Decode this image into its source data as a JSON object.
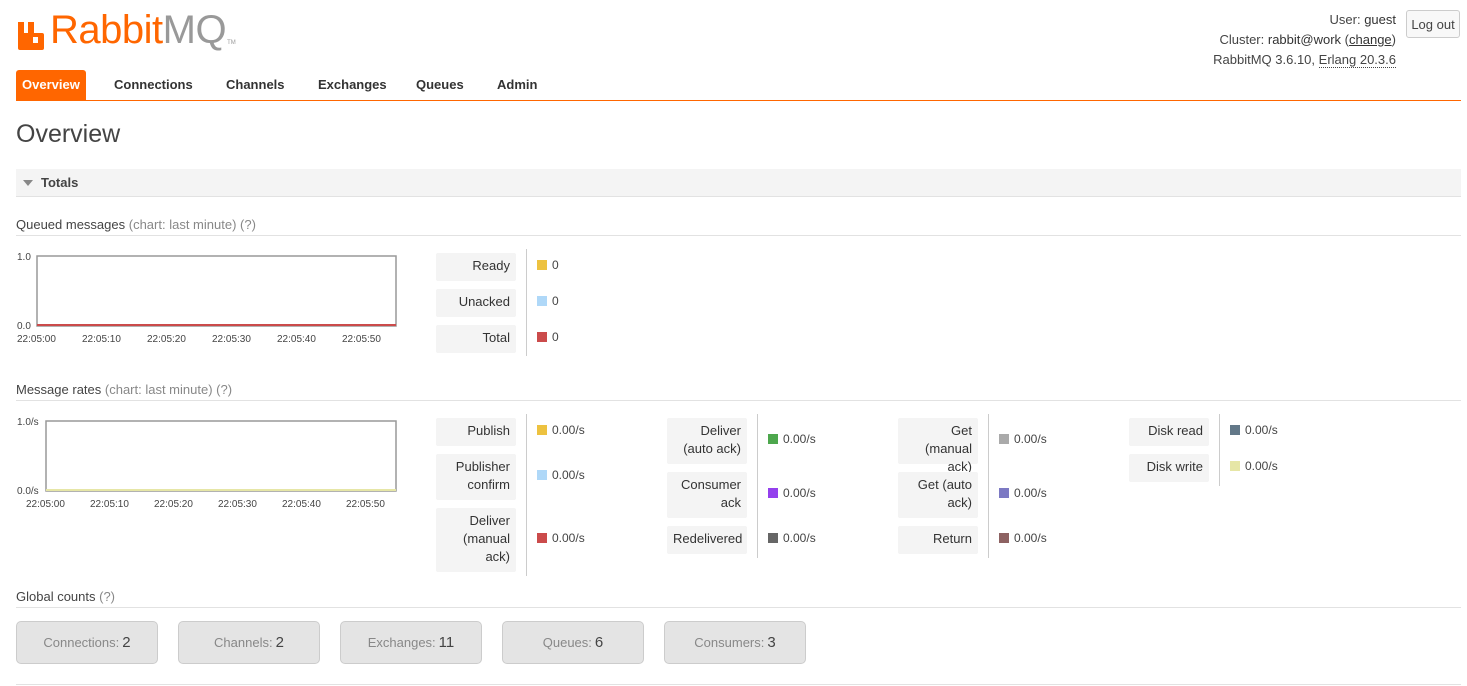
{
  "brand": {
    "name_a": "Rabbit",
    "name_b": "MQ",
    "tm": "TM",
    "color": "#ff6600"
  },
  "user": {
    "user_label": "User:",
    "user_name": "guest",
    "cluster_label": "Cluster:",
    "cluster_name": "rabbit@work",
    "change_label": "change",
    "version": "RabbitMQ 3.6.10,",
    "erlang": "Erlang 20.3.6",
    "logout_label": "Log out"
  },
  "nav": {
    "tabs": [
      {
        "label": "Overview",
        "active": true
      },
      {
        "label": "Connections"
      },
      {
        "label": "Channels"
      },
      {
        "label": "Exchanges"
      },
      {
        "label": "Queues"
      },
      {
        "label": "Admin"
      }
    ]
  },
  "page": {
    "title": "Overview"
  },
  "totals": {
    "label": "Totals"
  },
  "queued": {
    "heading": "Queued messages",
    "chart_note": "(chart: last minute) (?)",
    "legend": [
      {
        "label": "Ready",
        "value": "0",
        "color": "#edc240"
      },
      {
        "label": "Unacked",
        "value": "0",
        "color": "#afd8f8"
      },
      {
        "label": "Total",
        "value": "0",
        "color": "#cb4b4b"
      }
    ]
  },
  "rates": {
    "heading": "Message rates",
    "chart_note": "(chart: last minute) (?)",
    "col1": [
      {
        "label": "Publish",
        "value": "0.00/s",
        "color": "#edc240"
      },
      {
        "label": "Publisher confirm",
        "value": "0.00/s",
        "color": "#afd8f8"
      },
      {
        "label": "Deliver (manual ack)",
        "value": "0.00/s",
        "color": "#cb4b4b"
      }
    ],
    "col2": [
      {
        "label": "Deliver (auto ack)",
        "value": "0.00/s",
        "color": "#4da74d"
      },
      {
        "label": "Consumer ack",
        "value": "0.00/s",
        "color": "#9440ed"
      },
      {
        "label": "Redelivered",
        "value": "0.00/s",
        "color": "#666666"
      }
    ],
    "col3": [
      {
        "label": "Get (manual ack)",
        "value": "0.00/s",
        "color": "#aaaaaa"
      },
      {
        "label": "Get (auto ack)",
        "value": "0.00/s",
        "color": "#7c79c3"
      },
      {
        "label": "Return",
        "value": "0.00/s",
        "color": "#8d6262"
      }
    ],
    "col4": [
      {
        "label": "Disk read",
        "value": "0.00/s",
        "color": "#637888"
      },
      {
        "label": "Disk write",
        "value": "0.00/s",
        "color": "#e6e6a6"
      }
    ]
  },
  "global": {
    "heading": "Global counts",
    "note": "(?)",
    "counts": [
      {
        "label": "Connections:",
        "value": "2"
      },
      {
        "label": "Channels:",
        "value": "2"
      },
      {
        "label": "Exchanges:",
        "value": "11"
      },
      {
        "label": "Queues:",
        "value": "6"
      },
      {
        "label": "Consumers:",
        "value": "3"
      }
    ]
  },
  "chart_data": [
    {
      "type": "line",
      "title": "Queued messages",
      "x": [
        "22:05:00",
        "22:05:10",
        "22:05:20",
        "22:05:30",
        "22:05:40",
        "22:05:50"
      ],
      "y_ticks": [
        "1.0",
        "0.0"
      ],
      "ylim": [
        0,
        1
      ],
      "series": [
        {
          "name": "Ready",
          "values": [
            0,
            0,
            0,
            0,
            0,
            0
          ]
        },
        {
          "name": "Unacked",
          "values": [
            0,
            0,
            0,
            0,
            0,
            0
          ]
        },
        {
          "name": "Total",
          "values": [
            0,
            0,
            0,
            0,
            0,
            0
          ]
        }
      ],
      "grid": false
    },
    {
      "type": "line",
      "title": "Message rates",
      "x": [
        "22:05:00",
        "22:05:10",
        "22:05:20",
        "22:05:30",
        "22:05:40",
        "22:05:50"
      ],
      "y_ticks": [
        "1.0/s",
        "0.0/s"
      ],
      "ylim": [
        0,
        1
      ],
      "series": [
        {
          "name": "Publish",
          "values": [
            0,
            0,
            0,
            0,
            0,
            0
          ]
        },
        {
          "name": "Disk write",
          "values": [
            0,
            0,
            0,
            0,
            0,
            0
          ]
        }
      ],
      "grid": false
    }
  ]
}
